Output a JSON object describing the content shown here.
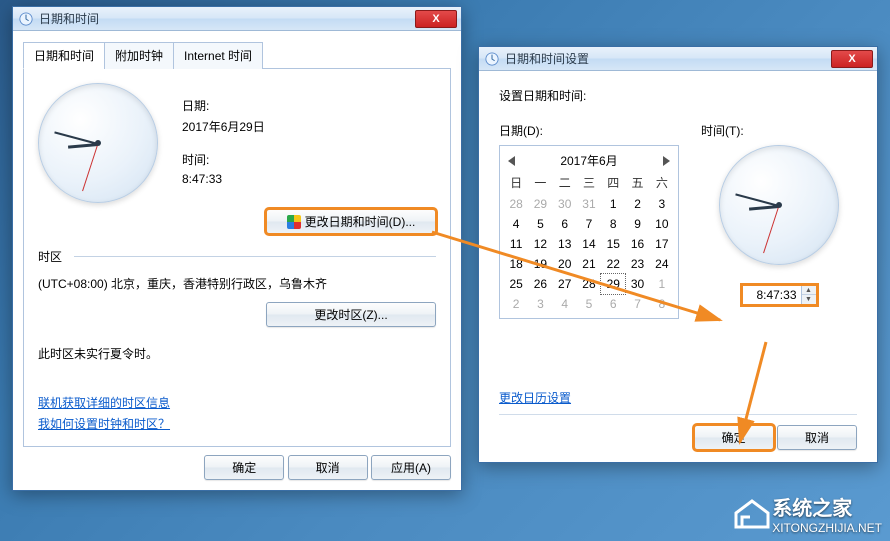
{
  "dialog1": {
    "title": "日期和时间",
    "tabs": {
      "datetime": "日期和时间",
      "additional": "附加时钟",
      "internet": "Internet 时间"
    },
    "panel": {
      "date_label": "日期:",
      "date_value": "2017年6月29日",
      "time_label": "时间:",
      "time_value": "8:47:33",
      "change_datetime_btn": "更改日期和时间(D)...",
      "tz_header": "时区",
      "tz_value": "(UTC+08:00) 北京，重庆，香港特别行政区，乌鲁木齐",
      "change_tz_btn": "更改时区(Z)...",
      "dst_note": "此时区未实行夏令时。",
      "link_tz_info": "联机获取详细的时区信息",
      "link_how": "我如何设置时钟和时区？"
    },
    "buttons": {
      "ok": "确定",
      "cancel": "取消",
      "apply": "应用(A)"
    }
  },
  "dialog2": {
    "title": "日期和时间设置",
    "subtitle": "设置日期和时间:",
    "date_label": "日期(D):",
    "time_label": "时间(T):",
    "month_label": "2017年6月",
    "weekdays": [
      "日",
      "一",
      "二",
      "三",
      "四",
      "五",
      "六"
    ],
    "grid": [
      [
        {
          "d": "28",
          "g": true
        },
        {
          "d": "29",
          "g": true
        },
        {
          "d": "30",
          "g": true
        },
        {
          "d": "31",
          "g": true
        },
        {
          "d": "1"
        },
        {
          "d": "2"
        },
        {
          "d": "3"
        }
      ],
      [
        {
          "d": "4"
        },
        {
          "d": "5"
        },
        {
          "d": "6"
        },
        {
          "d": "7"
        },
        {
          "d": "8"
        },
        {
          "d": "9"
        },
        {
          "d": "10"
        }
      ],
      [
        {
          "d": "11"
        },
        {
          "d": "12"
        },
        {
          "d": "13"
        },
        {
          "d": "14"
        },
        {
          "d": "15"
        },
        {
          "d": "16"
        },
        {
          "d": "17"
        }
      ],
      [
        {
          "d": "18"
        },
        {
          "d": "19"
        },
        {
          "d": "20"
        },
        {
          "d": "21"
        },
        {
          "d": "22"
        },
        {
          "d": "23"
        },
        {
          "d": "24"
        }
      ],
      [
        {
          "d": "25"
        },
        {
          "d": "26"
        },
        {
          "d": "27"
        },
        {
          "d": "28"
        },
        {
          "d": "29",
          "today": true
        },
        {
          "d": "30"
        },
        {
          "d": "1",
          "g": true
        }
      ],
      [
        {
          "d": "2",
          "g": true
        },
        {
          "d": "3",
          "g": true
        },
        {
          "d": "4",
          "g": true
        },
        {
          "d": "5",
          "g": true
        },
        {
          "d": "6",
          "g": true
        },
        {
          "d": "7",
          "g": true
        },
        {
          "d": "8",
          "g": true
        }
      ]
    ],
    "time_value": "8:47:33",
    "calendar_settings_link": "更改日历设置",
    "buttons": {
      "ok": "确定",
      "cancel": "取消"
    }
  },
  "watermark": {
    "name": "系统之家",
    "url": "XITONGZHIJIA.NET"
  }
}
